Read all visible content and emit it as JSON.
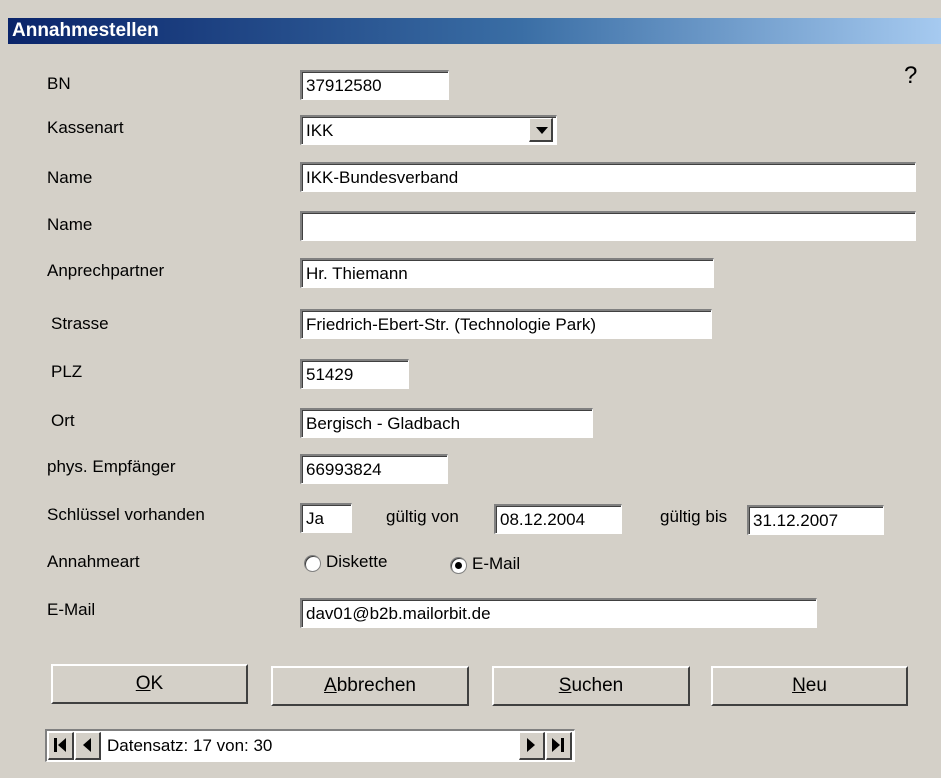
{
  "window": {
    "title": "Annahmestellen",
    "help": "?"
  },
  "labels": {
    "bn": "BN",
    "kassenart": "Kassenart",
    "name1": "Name",
    "name2": "Name",
    "anprechpartner": "Anprechpartner",
    "strasse": "Strasse",
    "plz": "PLZ",
    "ort": "Ort",
    "phys_empfaenger": "phys. Empfänger",
    "schluessel": "Schlüssel vorhanden",
    "gueltig_von": "gültig von",
    "gueltig_bis": "gültig bis",
    "annahmeart": "Annahmeart",
    "email": "E-Mail"
  },
  "fields": {
    "bn": "37912580",
    "kassenart": "IKK",
    "name1": "IKK-Bundesverband",
    "name2": "",
    "anprechpartner": "Hr. Thiemann",
    "strasse": "Friedrich-Ebert-Str. (Technologie Park)",
    "plz": "51429",
    "ort": "Bergisch - Gladbach",
    "phys_empfaenger": "66993824",
    "schluessel": "Ja",
    "gueltig_von": "08.12.2004",
    "gueltig_bis": "31.12.2007",
    "email": "dav01@b2b.mailorbit.de"
  },
  "annahmeart": {
    "options": [
      "Diskette",
      "E-Mail"
    ],
    "selected": "E-Mail"
  },
  "buttons": {
    "ok": {
      "underline": "O",
      "rest": "K"
    },
    "abbrechen": {
      "underline": "A",
      "rest": "bbrechen"
    },
    "suchen": {
      "underline": "S",
      "rest": "uchen"
    },
    "neu": {
      "underline": "N",
      "rest": "eu"
    }
  },
  "navigator": {
    "text": "Datensatz: 17 von: 30"
  },
  "colors": {
    "face": "#d4d0c8",
    "title_start": "#0a246a",
    "title_end": "#a6caf0"
  }
}
